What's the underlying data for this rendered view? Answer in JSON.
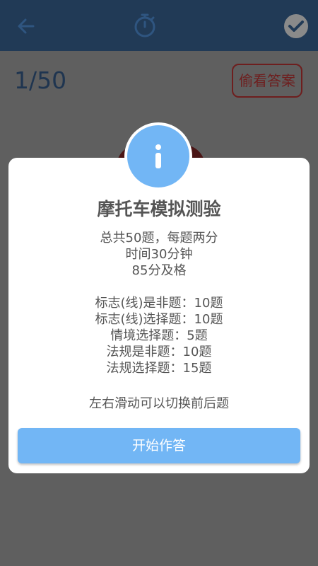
{
  "header": {
    "back_icon": "arrow-left-icon",
    "timer_icon": "stopwatch-icon",
    "submit_icon": "check-circle-icon"
  },
  "question_counter": "1/50",
  "peek_answer_label": "偷看答案",
  "dialog": {
    "icon": "info-icon",
    "title": "摩托车模拟测验",
    "summary": [
      "总共50题，每题两分",
      "时间30分钟",
      "85分及格"
    ],
    "breakdown": [
      "标志(线)是非题：10题",
      "标志(线)选择题：10题",
      "情境选择题：5题",
      "法规是非题：10题",
      "法规选择题：15题"
    ],
    "hint": "左右滑动可以切换前后题",
    "start_label": "开始作答"
  },
  "colors": {
    "header_bg": "#213a56",
    "accent_blue": "#72b6f5",
    "peek_red": "#6e1e1e",
    "overlay_bg": "#5f5f5f"
  }
}
